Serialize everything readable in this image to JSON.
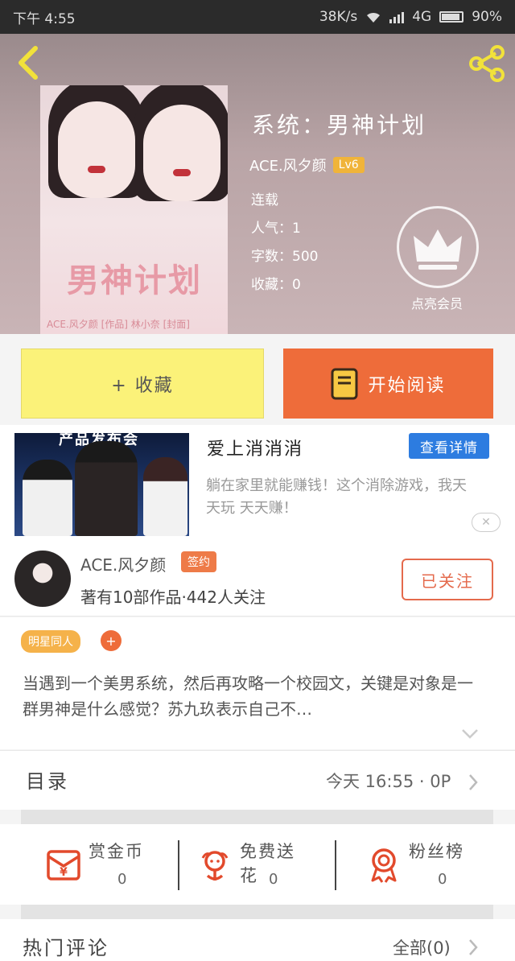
{
  "status_bar": {
    "time": "下午 4:55",
    "speed": "38K/s",
    "network": "4G",
    "battery": "90%"
  },
  "book": {
    "title": "系统：男神计划",
    "author": "ACE.风夕颜",
    "level": "Lv6",
    "status": "连载",
    "popularity": "人气：1",
    "words": "字数：500",
    "collections": "收藏：0",
    "cover_title": "男神计划",
    "cover_credit": "ACE.风夕颜 [作品]   林小奈 [封面]"
  },
  "vip": {
    "label": "点亮会员"
  },
  "actions": {
    "collect_label": "+ 收藏",
    "read_label": "开始阅读"
  },
  "ad": {
    "banner_text": "产品发布会",
    "title": "爱上消消消",
    "detail_label": "查看详情",
    "description": "躺在家里就能赚钱！这个消除游戏，我天天玩 天天赚！",
    "close_label": "✕"
  },
  "author": {
    "name": "ACE.风夕颜",
    "badge": "签约",
    "stats": "著有10部作品·442人关注",
    "follow_label": "已关注"
  },
  "synopsis": {
    "tag": "明星同人",
    "tag_add": "+",
    "text": "当遇到一个美男系统，然后再攻略一个校园文，关键是对象是一群男神是什么感觉？苏九玖表示自己不…"
  },
  "catalog": {
    "label": "目录",
    "update": "今天 16:55 · 0P"
  },
  "gifts": [
    {
      "label": "赏金币",
      "count": "0",
      "icon": "red-envelope-icon"
    },
    {
      "label": "免费送花",
      "count": "0",
      "icon": "flower-icon"
    },
    {
      "label": "粉丝榜",
      "count": "0",
      "icon": "ribbon-medal-icon"
    }
  ],
  "comments": {
    "label": "热门评论",
    "all_label": "全部(0)"
  },
  "colors": {
    "accent_orange": "#ee6c3a",
    "collect_yellow": "#fbf279",
    "detail_blue": "#2d7ce0",
    "level_gold": "#f0b43a",
    "gift_red": "#e24a2c"
  }
}
